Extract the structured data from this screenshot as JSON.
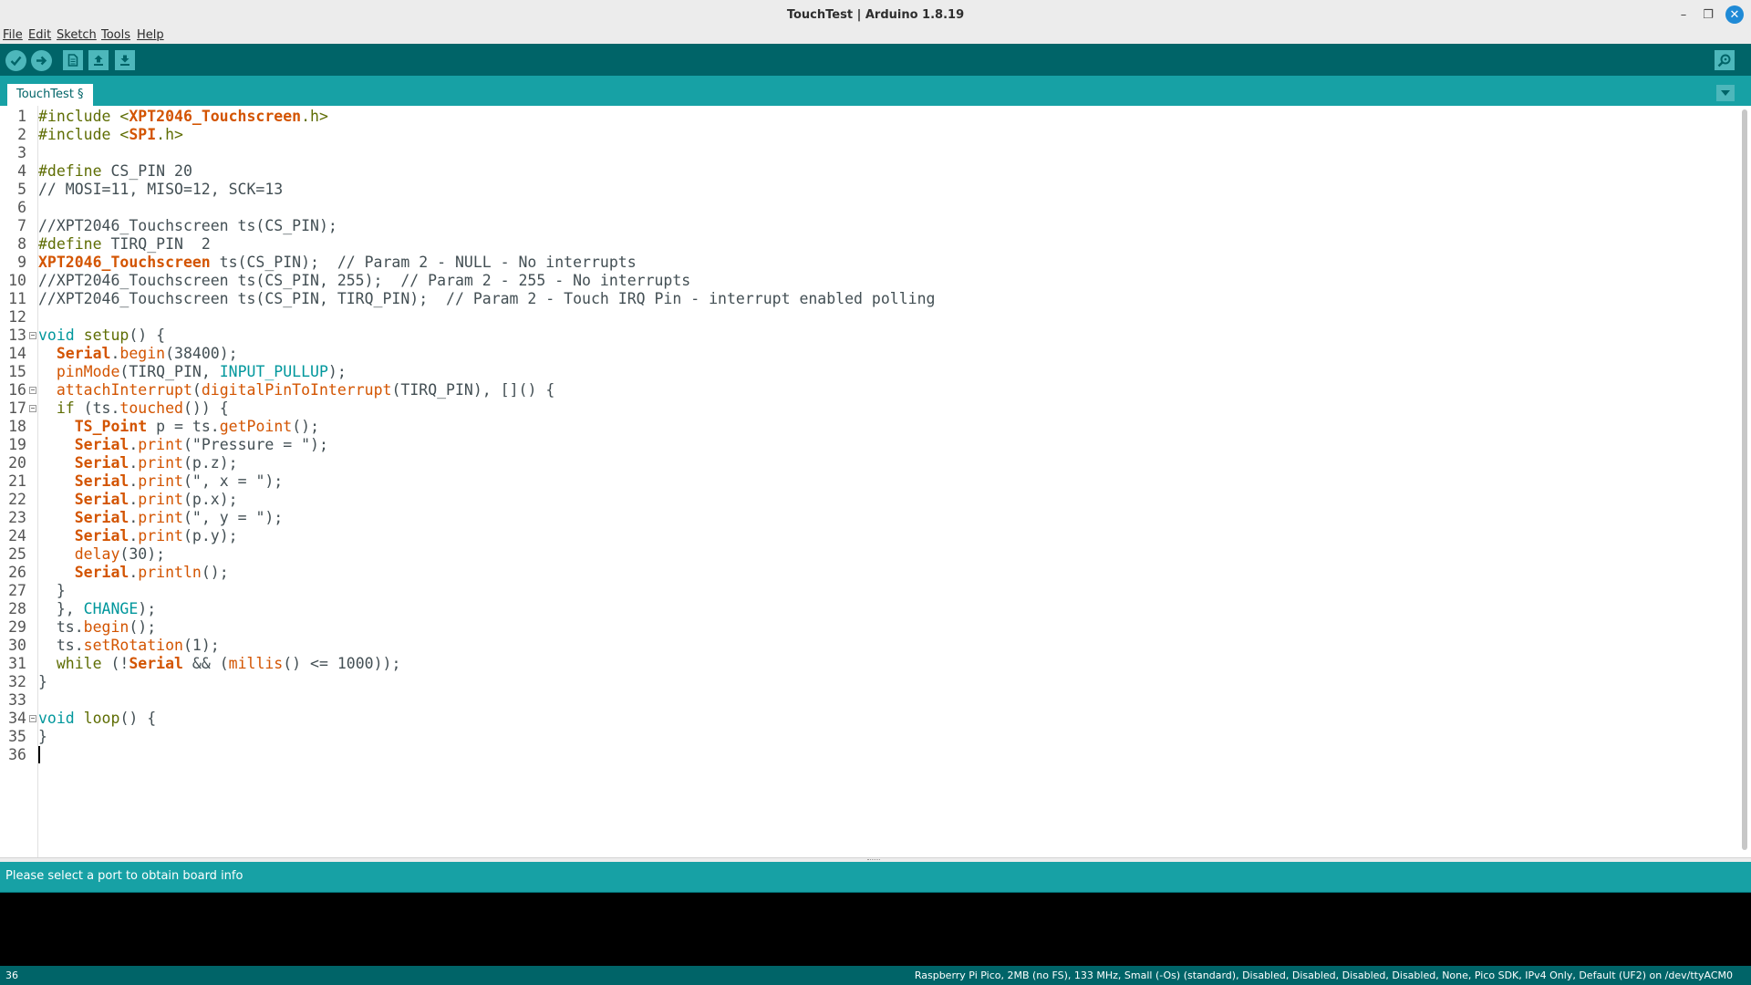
{
  "window": {
    "title": "TouchTest | Arduino 1.8.19",
    "controls": {
      "minimize": "–",
      "maximize": "❐",
      "close": "✕"
    }
  },
  "menu": [
    "File",
    "Edit",
    "Sketch",
    "Tools",
    "Help"
  ],
  "toolbar": {
    "buttons": [
      "verify-icon",
      "upload-icon",
      "new-icon",
      "open-icon",
      "save-icon"
    ],
    "right": "serial-monitor-icon",
    "colors": {
      "bar": "#006468",
      "button": "#4db7bb"
    }
  },
  "tab": {
    "label": "TouchTest §"
  },
  "editor": {
    "lines": [
      [
        {
          "t": "#include <",
          "c": "c-pre"
        },
        {
          "t": "XPT2046_Touchscreen",
          "c": "c-lib"
        },
        {
          "t": ".h>",
          "c": "c-pre"
        }
      ],
      [
        {
          "t": "#include <",
          "c": "c-pre"
        },
        {
          "t": "SPI",
          "c": "c-lib"
        },
        {
          "t": ".h>",
          "c": "c-pre"
        }
      ],
      [],
      [
        {
          "t": "#define",
          "c": "c-pre"
        },
        {
          "t": " CS_PIN 20",
          "c": ""
        }
      ],
      [
        {
          "t": "// MOSI=11, MISO=12, SCK=13",
          "c": "c-comment"
        }
      ],
      [],
      [
        {
          "t": "//XPT2046_Touchscreen ts(CS_PIN);",
          "c": "c-comment"
        }
      ],
      [
        {
          "t": "#define",
          "c": "c-pre"
        },
        {
          "t": " TIRQ_PIN  2",
          "c": ""
        }
      ],
      [
        {
          "t": "XPT2046_Touchscreen",
          "c": "c-cls"
        },
        {
          "t": " ts(CS_PIN);  // Param 2 - NULL - No interrupts",
          "c": ""
        }
      ],
      [
        {
          "t": "//XPT2046_Touchscreen ts(CS_PIN, 255);  // Param 2 - 255 - No interrupts",
          "c": "c-comment"
        }
      ],
      [
        {
          "t": "//XPT2046_Touchscreen ts(CS_PIN, TIRQ_PIN);  // Param 2 - Touch IRQ Pin - interrupt enabled polling",
          "c": "c-comment"
        }
      ],
      [],
      [
        {
          "t": "void",
          "c": "c-kw"
        },
        {
          "t": " ",
          "c": ""
        },
        {
          "t": "setup",
          "c": "c-ctrl"
        },
        {
          "t": "() {",
          "c": ""
        }
      ],
      [
        {
          "t": "  ",
          "c": ""
        },
        {
          "t": "Serial",
          "c": "c-cls"
        },
        {
          "t": ".",
          "c": ""
        },
        {
          "t": "begin",
          "c": "c-fn"
        },
        {
          "t": "(38400);",
          "c": ""
        }
      ],
      [
        {
          "t": "  ",
          "c": ""
        },
        {
          "t": "pinMode",
          "c": "c-fn"
        },
        {
          "t": "(TIRQ_PIN, ",
          "c": ""
        },
        {
          "t": "INPUT_PULLUP",
          "c": "c-const"
        },
        {
          "t": ");",
          "c": ""
        }
      ],
      [
        {
          "t": "  ",
          "c": ""
        },
        {
          "t": "attachInterrupt",
          "c": "c-fn"
        },
        {
          "t": "(",
          "c": ""
        },
        {
          "t": "digitalPinToInterrupt",
          "c": "c-fn"
        },
        {
          "t": "(TIRQ_PIN), []() {",
          "c": ""
        }
      ],
      [
        {
          "t": "  ",
          "c": ""
        },
        {
          "t": "if",
          "c": "c-ctrl"
        },
        {
          "t": " (ts.",
          "c": ""
        },
        {
          "t": "touched",
          "c": "c-fn"
        },
        {
          "t": "()) {",
          "c": ""
        }
      ],
      [
        {
          "t": "    ",
          "c": ""
        },
        {
          "t": "TS_Point",
          "c": "c-cls"
        },
        {
          "t": " p = ts.",
          "c": ""
        },
        {
          "t": "getPoint",
          "c": "c-fn"
        },
        {
          "t": "();",
          "c": ""
        }
      ],
      [
        {
          "t": "    ",
          "c": ""
        },
        {
          "t": "Serial",
          "c": "c-cls"
        },
        {
          "t": ".",
          "c": ""
        },
        {
          "t": "print",
          "c": "c-fn"
        },
        {
          "t": "(\"Pressure = \");",
          "c": ""
        }
      ],
      [
        {
          "t": "    ",
          "c": ""
        },
        {
          "t": "Serial",
          "c": "c-cls"
        },
        {
          "t": ".",
          "c": ""
        },
        {
          "t": "print",
          "c": "c-fn"
        },
        {
          "t": "(p.z);",
          "c": ""
        }
      ],
      [
        {
          "t": "    ",
          "c": ""
        },
        {
          "t": "Serial",
          "c": "c-cls"
        },
        {
          "t": ".",
          "c": ""
        },
        {
          "t": "print",
          "c": "c-fn"
        },
        {
          "t": "(\", x = \");",
          "c": ""
        }
      ],
      [
        {
          "t": "    ",
          "c": ""
        },
        {
          "t": "Serial",
          "c": "c-cls"
        },
        {
          "t": ".",
          "c": ""
        },
        {
          "t": "print",
          "c": "c-fn"
        },
        {
          "t": "(p.x);",
          "c": ""
        }
      ],
      [
        {
          "t": "    ",
          "c": ""
        },
        {
          "t": "Serial",
          "c": "c-cls"
        },
        {
          "t": ".",
          "c": ""
        },
        {
          "t": "print",
          "c": "c-fn"
        },
        {
          "t": "(\", y = \");",
          "c": ""
        }
      ],
      [
        {
          "t": "    ",
          "c": ""
        },
        {
          "t": "Serial",
          "c": "c-cls"
        },
        {
          "t": ".",
          "c": ""
        },
        {
          "t": "print",
          "c": "c-fn"
        },
        {
          "t": "(p.y);",
          "c": ""
        }
      ],
      [
        {
          "t": "    ",
          "c": ""
        },
        {
          "t": "delay",
          "c": "c-fn"
        },
        {
          "t": "(30);",
          "c": ""
        }
      ],
      [
        {
          "t": "    ",
          "c": ""
        },
        {
          "t": "Serial",
          "c": "c-cls"
        },
        {
          "t": ".",
          "c": ""
        },
        {
          "t": "println",
          "c": "c-fn"
        },
        {
          "t": "();",
          "c": ""
        }
      ],
      [
        {
          "t": "  }",
          "c": ""
        }
      ],
      [
        {
          "t": "  }, ",
          "c": ""
        },
        {
          "t": "CHANGE",
          "c": "c-const"
        },
        {
          "t": ");",
          "c": ""
        }
      ],
      [
        {
          "t": "  ts.",
          "c": ""
        },
        {
          "t": "begin",
          "c": "c-fn"
        },
        {
          "t": "();",
          "c": ""
        }
      ],
      [
        {
          "t": "  ts.",
          "c": ""
        },
        {
          "t": "setRotation",
          "c": "c-fn"
        },
        {
          "t": "(1);",
          "c": ""
        }
      ],
      [
        {
          "t": "  ",
          "c": ""
        },
        {
          "t": "while",
          "c": "c-ctrl"
        },
        {
          "t": " (!",
          "c": ""
        },
        {
          "t": "Serial",
          "c": "c-cls"
        },
        {
          "t": " && (",
          "c": ""
        },
        {
          "t": "millis",
          "c": "c-fn"
        },
        {
          "t": "() <= 1000));",
          "c": ""
        }
      ],
      [
        {
          "t": "}",
          "c": ""
        }
      ],
      [],
      [
        {
          "t": "void",
          "c": "c-kw"
        },
        {
          "t": " ",
          "c": ""
        },
        {
          "t": "loop",
          "c": "c-ctrl"
        },
        {
          "t": "() {",
          "c": ""
        }
      ],
      [
        {
          "t": "}",
          "c": ""
        }
      ],
      []
    ],
    "fold_lines": [
      13,
      16,
      17,
      34
    ],
    "caret_line": 36
  },
  "status": {
    "message": "Please select a port to obtain board info"
  },
  "bottom": {
    "line_number": "36",
    "board": "Raspberry Pi Pico, 2MB (no FS), 133 MHz, Small (-Os) (standard), Disabled, Disabled, Disabled, Disabled, None, Pico SDK, IPv4 Only, Default (UF2) on /dev/ttyACM0"
  }
}
